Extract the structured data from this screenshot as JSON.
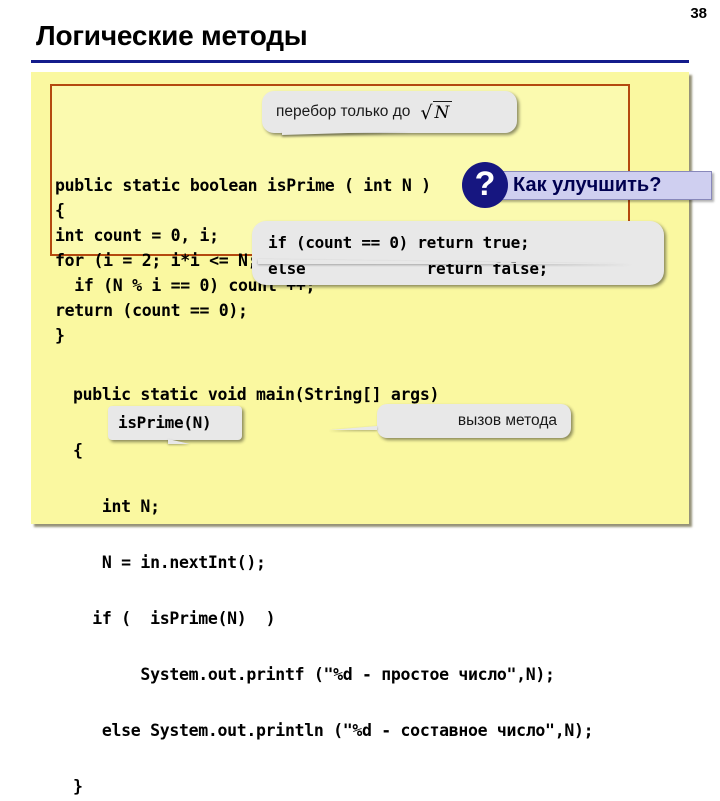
{
  "slide": {
    "number": "38",
    "title": "Логические методы"
  },
  "method_code": "public static boolean isPrime ( int N )\n{\nint count = 0, i;\nfor (i = 2; i*i <= N; i++)\n  if (N % i == 0) count ++;\nreturn (count == 0);\n}",
  "main_code": "public static void main(String[] args)\n\n{\n\n   int N;\n\n   N = in.nextInt();\n\n  if (  isPrime(N)  )\n\n       System.out.printf (\"%d - простое число\",N);\n\n   else System.out.println (\"%d - составное число\",N);\n\n}",
  "callouts": {
    "sqrt_note": {
      "text": "перебор только до",
      "formula_sign": "√",
      "formula_radicand": "N"
    },
    "if_count": {
      "line1": "if (count == 0) return true;",
      "line2": "else             return false;"
    },
    "isprime_highlight": {
      "text": "isPrime(N)"
    },
    "method_call": {
      "text": "вызов метода"
    }
  },
  "improve_badge": {
    "label": "Как улучшить?",
    "icon_glyph": "?"
  },
  "colors": {
    "panel_background": "#FAF8A0",
    "method_box_border": "#B4490F",
    "title_rule": "#141C8C",
    "badge_background": "#CFCFF0",
    "badge_text": "#000050",
    "icon_circle": "#161680",
    "callout_background": "#E8E8E8"
  }
}
